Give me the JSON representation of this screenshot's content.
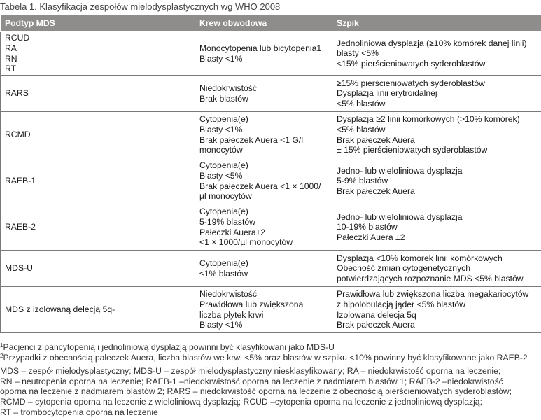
{
  "caption": "Tabela 1. Klasyfikacja zespołów mielodysplastycznych wg WHO 2008",
  "headers": [
    "Podtyp MDS",
    "Krew obwodowa",
    "Szpik"
  ],
  "rows": [
    {
      "subtype": [
        "RCUD",
        "RA",
        "RN",
        "RT"
      ],
      "blood": [
        "Monocytopenia lub bicytopenia1",
        "Blasty <1%"
      ],
      "marrow": [
        "Jednoliniowa dysplazja (≥10% komórek danej linii)",
        "blasty <5%",
        "<15% pierścieniowatych syderoblastów"
      ]
    },
    {
      "subtype": [
        "RARS"
      ],
      "blood": [
        "Niedokrwistość",
        "Brak blastów"
      ],
      "marrow": [
        "≥15% pierścieniowatych syderoblastów",
        "Dysplazja linii erytroidalnej",
        "<5% blastów"
      ]
    },
    {
      "subtype": [
        "RCMD"
      ],
      "blood": [
        "Cytopenia(e)",
        "Blasty <1%",
        "Brak pałeczek Auera <1 G/l",
        "monocytów"
      ],
      "marrow": [
        "Dysplazja ≥2 linii komórkowych (>10% komórek)",
        "<5% blastów",
        "Brak pałeczek Auera",
        "± 15% pierścieniowatych syderoblastów"
      ]
    },
    {
      "subtype": [
        "RAEB-1"
      ],
      "blood": [
        "Cytopenia(e)",
        "Blasty <5%",
        "Brak pałeczek Auera <1 × 1000/",
        "µl monocytów"
      ],
      "marrow": [
        "Jedno- lub wieloliniowa dysplazja",
        "5-9% blastów",
        "Brak pałeczek Auera"
      ]
    },
    {
      "subtype": [
        "RAEB-2"
      ],
      "blood": [
        "Cytopenia(e)",
        "5-19% blastów",
        "Pałeczki Auera±2",
        "<1 × 1000/µl monocytów"
      ],
      "marrow": [
        "Jedno- lub wieloliniowa dysplazja",
        "10-19% blastów",
        "Pałeczki Auera ±2"
      ]
    },
    {
      "subtype": [
        "MDS-U"
      ],
      "blood": [
        "Cytopenia(e)",
        "≤1% blastów"
      ],
      "marrow": [
        "Dysplazja <10% komórek linii komórkowych",
        "Obecność zmian cytogenetycznych",
        "potwierdzających rozpoznanie MDS <5% blastów"
      ]
    },
    {
      "subtype": [
        "MDS z izolowaną delecją 5q-"
      ],
      "blood": [
        "Niedokrwistość",
        "Prawidłowa lub zwiększona",
        "liczba płytek krwi",
        "Blasty <1%"
      ],
      "marrow": [
        "Prawidłowa lub zwiększona liczba megakariocytów",
        "z hipolobulacją jąder <5% blastów",
        "Izolowana delecja 5q",
        "Brak pałeczek Auera"
      ]
    }
  ],
  "footnotes": [
    {
      "mark": "1",
      "text": "Pacjenci z pancytopenią i jednoliniową dysplazją powinni być klasyfikowani jako MDS-U"
    },
    {
      "mark": "2",
      "text": "Przypadki z obecnością pałeczek Auera, liczba blastów we krwi <5% oraz blastów w szpiku <10% powinny być klasyfikowane jako RAEB-2"
    }
  ],
  "abbreviations": [
    "MDS – zespół mielodysplastyczny; MDS-U – zespół mielodysplastyczny niesklasyfikowany; RA – niedokrwistość oporna na leczenie;",
    "RN – neutropenia oporna na leczenie; RAEB-1 –niedokrwistość oporna na leczenie z nadmiarem blastów 1; RAEB-2 –niedokrwistość",
    "oporna na leczenie z nadmiarem blastów 2; RARS – niedokrwistość oporna na leczenie z obecnością pierścieniowatych syderoblastów;",
    "RCMD – cytopenia oporna na leczenie z wieloliniową dysplazją; RCUD –cytopenia oporna na leczenie z jednoliniową dysplazją;",
    "RT – trombocytopenia oporna na leczenie"
  ]
}
